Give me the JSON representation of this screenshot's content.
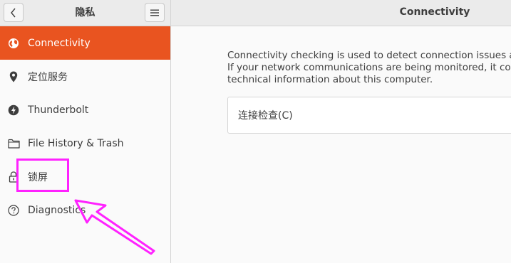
{
  "header": {
    "sidebar_title": "隐私",
    "page_title": "Connectivity",
    "back_icon": "chevron-left-icon",
    "menu_icon": "hamburger-menu-icon"
  },
  "sidebar": {
    "items": [
      {
        "label": "Connectivity",
        "icon": "globe-icon",
        "active": true
      },
      {
        "label": "定位服务",
        "icon": "location-pin-icon",
        "active": false
      },
      {
        "label": "Thunderbolt",
        "icon": "thunderbolt-icon",
        "active": false
      },
      {
        "label": "File History & Trash",
        "icon": "folder-icon",
        "active": false
      },
      {
        "label": "锁屏",
        "icon": "lock-icon",
        "active": false
      },
      {
        "label": "Diagnostics",
        "icon": "question-circle-icon",
        "active": false
      }
    ]
  },
  "content": {
    "description_lines": [
      "Connectivity checking is used to detect connection issues and automatically",
      "If your network communications are being monitored, it could be used to",
      "technical information about this computer."
    ],
    "connectivity_check_label": "连接检查(C)"
  },
  "colors": {
    "accent": "#e95420",
    "annotation": "#ff22ff",
    "header_bg": "#ebebeb",
    "sidebar_bg": "#fafafa"
  }
}
